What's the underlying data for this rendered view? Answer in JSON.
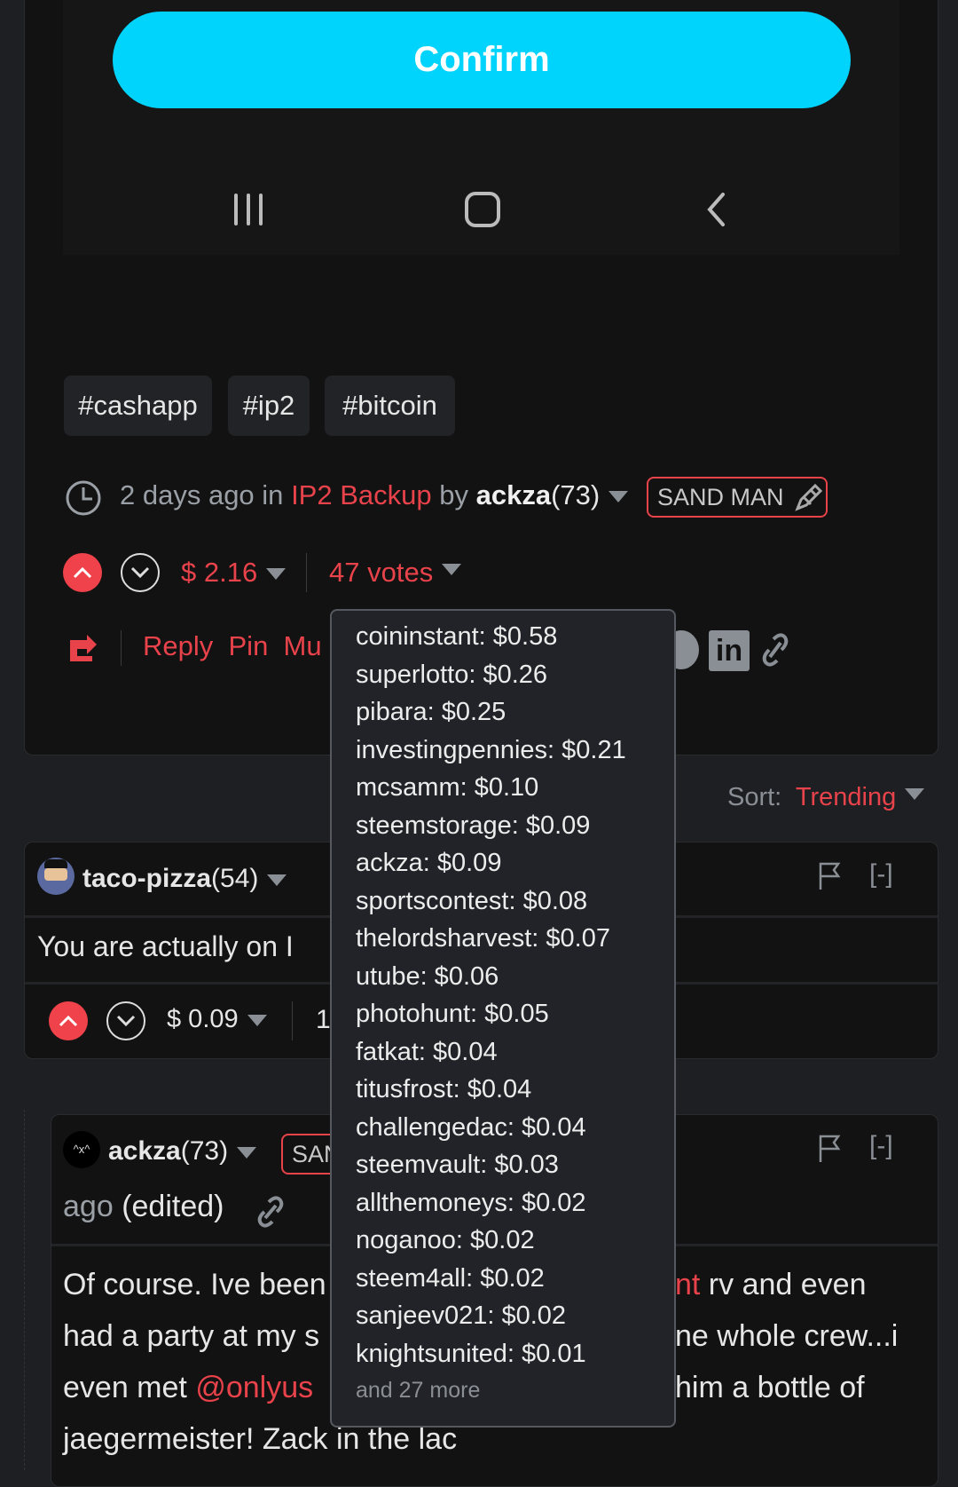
{
  "confirm_label": "Confirm",
  "accent": "#00d3fc",
  "brand_red": "#e8424b",
  "nav_icons": [
    "recent-apps-icon",
    "home-icon",
    "back-icon"
  ],
  "tags": [
    "#cashapp",
    "#ip2",
    "#bitcoin"
  ],
  "post": {
    "time": "2 days ago",
    "in": "in",
    "community": "IP2 Backup",
    "by": "by",
    "author": "ackza",
    "rep": "(73)",
    "badge": "SAND MAN",
    "payout": "$ 2.16",
    "votes": "47 votes",
    "actions": [
      "Reply",
      "Pin",
      "Mu"
    ]
  },
  "sort": {
    "label": "Sort:",
    "value": "Trending"
  },
  "comment1": {
    "author": "taco-pizza",
    "rep": "(54)",
    "text": "You are actually on I",
    "payout": "$ 0.09",
    "votes_partial": "1",
    "collapse": "[-]"
  },
  "comment2": {
    "author": "ackza",
    "rep": "(73)",
    "badge_partial": "SAN",
    "time_partial": "ago",
    "edited": "(edited)",
    "collapse": "[-]",
    "lines": [
      {
        "left": "Of course. Ive been",
        "link": "nt",
        "right": " rv and even"
      },
      {
        "left": "had a party at my s",
        "right": "ne whole crew...i"
      },
      {
        "left": "even met ",
        "mention": "@onlyus",
        "right": "him a bottle of"
      },
      {
        "left": "jaegermeister! Zack in the lac"
      }
    ]
  },
  "voters": [
    "coininstant: $0.58",
    "superlotto: $0.26",
    "pibara: $0.25",
    "investingpennies: $0.21",
    "mcsamm: $0.10",
    "steemstorage: $0.09",
    "ackza: $0.09",
    "sportscontest: $0.08",
    "thelordsharvest: $0.07",
    "utube: $0.06",
    "photohunt: $0.05",
    "fatkat: $0.04",
    "titusfrost: $0.04",
    "challengedac: $0.04",
    "steemvault: $0.03",
    "allthemoneys: $0.02",
    "noganoo: $0.02",
    "steem4all: $0.02",
    "sanjeev021: $0.02",
    "knightsunited: $0.01"
  ],
  "voters_more": "and 27 more"
}
